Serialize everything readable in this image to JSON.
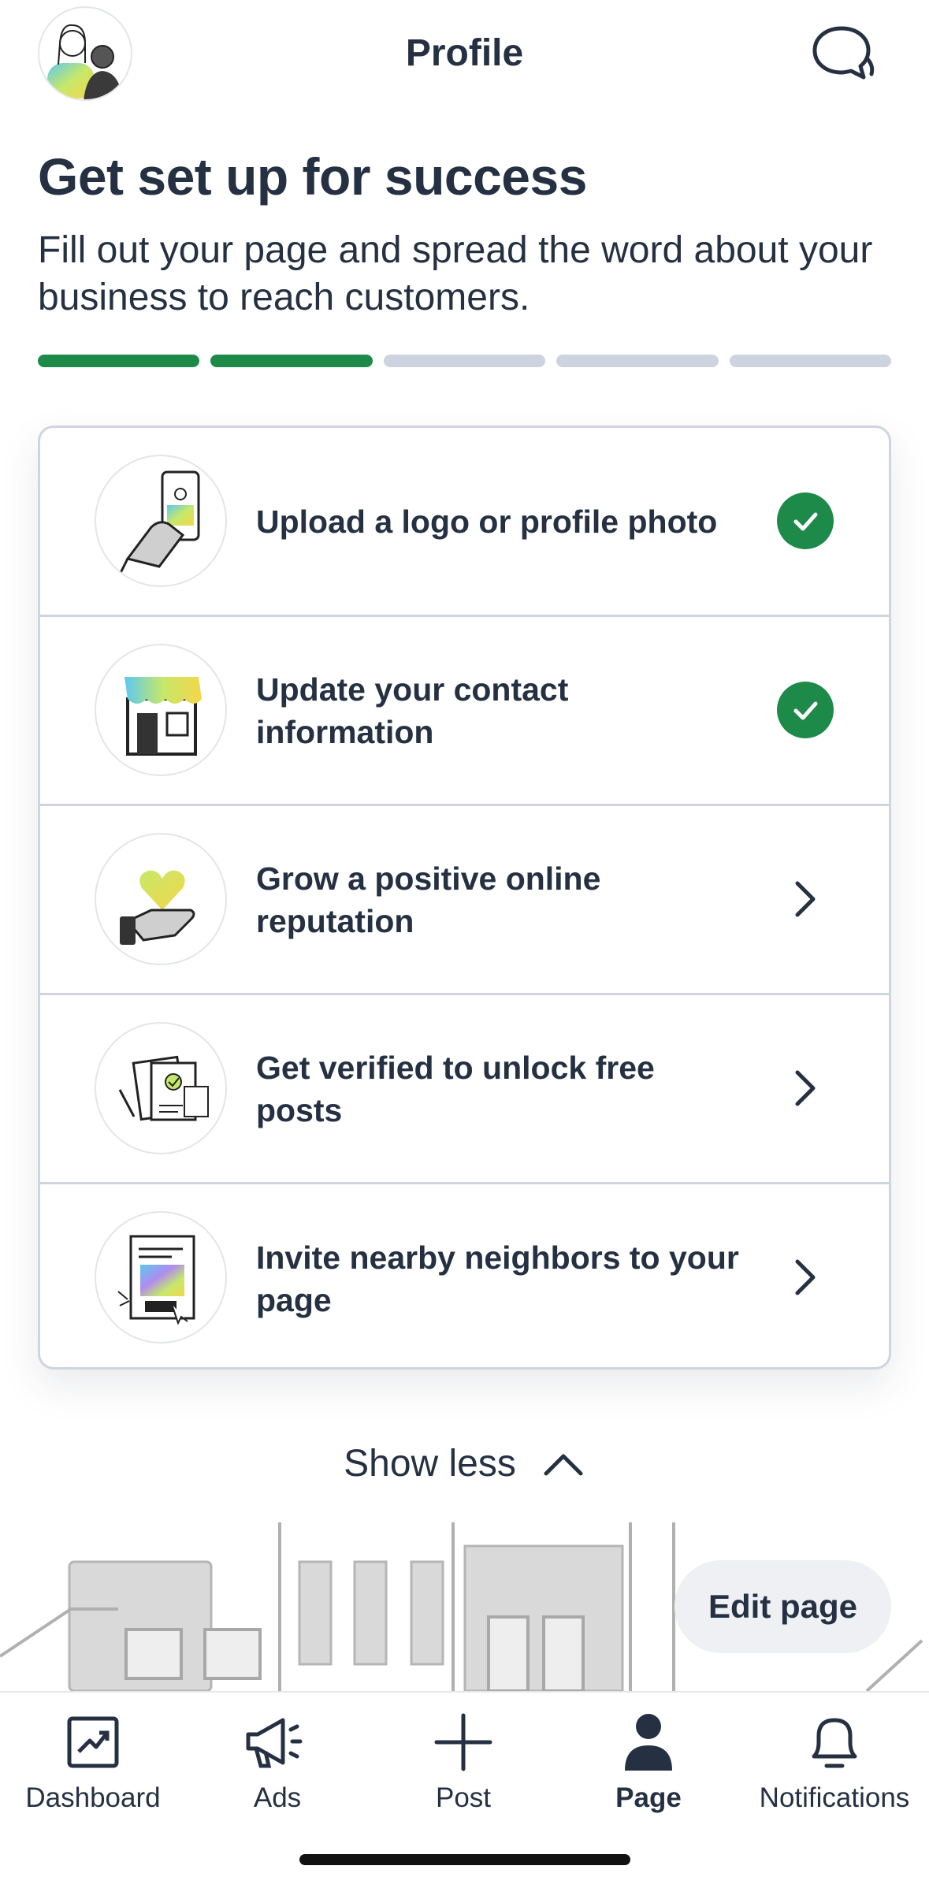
{
  "header": {
    "title": "Profile",
    "avatar_icon": "avatar-illustration-icon",
    "chat_icon": "chat-bubbles-icon"
  },
  "hero": {
    "headline": "Get set up for success",
    "subtext": "Fill out your page and spread the word about your business to reach customers."
  },
  "progress": {
    "completed_steps": 2,
    "total_steps": 5,
    "done_color": "#1d8a4a",
    "todo_color": "#cdd3df"
  },
  "checklist": [
    {
      "label": "Upload a logo or profile photo",
      "status": "done",
      "icon": "phone-photo-icon"
    },
    {
      "label": "Update your contact information",
      "status": "done",
      "icon": "storefront-icon"
    },
    {
      "label": "Grow a positive online reputation",
      "status": "todo",
      "icon": "heart-hand-icon"
    },
    {
      "label": "Get verified to unlock free posts",
      "status": "todo",
      "icon": "documents-icon"
    },
    {
      "label": "Invite nearby neighbors to your page",
      "status": "todo",
      "icon": "flyer-icon"
    }
  ],
  "show_less_label": "Show less",
  "edit_page_label": "Edit page",
  "tabs": [
    {
      "label": "Dashboard",
      "icon": "chart-icon",
      "active": false
    },
    {
      "label": "Ads",
      "icon": "megaphone-icon",
      "active": false
    },
    {
      "label": "Post",
      "icon": "plus-icon",
      "active": false
    },
    {
      "label": "Page",
      "icon": "person-icon",
      "active": true
    },
    {
      "label": "Notifications",
      "icon": "bell-icon",
      "active": false
    }
  ],
  "colors": {
    "text": "#253142",
    "accent_green": "#1d8a4a",
    "border": "#cfd5df"
  }
}
